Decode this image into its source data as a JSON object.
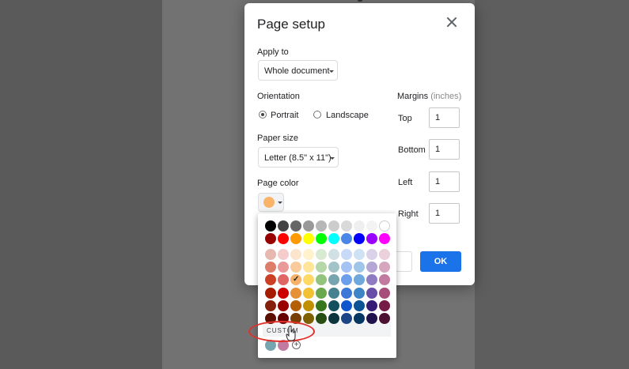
{
  "dialog": {
    "title": "Page setup",
    "apply_to": {
      "label": "Apply to",
      "value": "Whole document"
    },
    "orientation": {
      "label": "Orientation",
      "options": [
        {
          "label": "Portrait",
          "selected": true
        },
        {
          "label": "Landscape",
          "selected": false
        }
      ]
    },
    "paper_size": {
      "label": "Paper size",
      "value": "Letter (8.5\" x 11\")"
    },
    "page_color": {
      "label": "Page color",
      "value": "#f9b36b"
    },
    "margins": {
      "label": "Margins",
      "unit": "(inches)",
      "fields": [
        {
          "label": "Top",
          "value": "1"
        },
        {
          "label": "Bottom",
          "value": "1"
        },
        {
          "label": "Left",
          "value": "1"
        },
        {
          "label": "Right",
          "value": "1"
        }
      ]
    },
    "ok_label": "OK"
  },
  "palette": {
    "rows": [
      [
        "#000000",
        "#434343",
        "#666666",
        "#999999",
        "#b7b7b7",
        "#cccccc",
        "#d9d9d9",
        "#efefef",
        "#f3f3f3",
        "#ffffff"
      ],
      [
        "#980000",
        "#ff0000",
        "#ff9900",
        "#ffff00",
        "#00ff00",
        "#00ffff",
        "#4a86e8",
        "#0000ff",
        "#9900ff",
        "#ff00ff"
      ],
      [
        "#e6b8af",
        "#f4cccc",
        "#fce5cd",
        "#fff2cc",
        "#d9ead3",
        "#d0e0e3",
        "#c9daf8",
        "#cfe2f3",
        "#d9d2e9",
        "#ead1dc"
      ],
      [
        "#dd7e6b",
        "#ea9999",
        "#f9cb9c",
        "#ffe599",
        "#b6d7a8",
        "#a2c4c9",
        "#a4c2f4",
        "#9fc5e8",
        "#b4a7d6",
        "#d5a6bd"
      ],
      [
        "#cc4125",
        "#e06666",
        "#f6b26b",
        "#ffd966",
        "#93c47d",
        "#76a5af",
        "#6d9eeb",
        "#6fa8dc",
        "#8e7cc3",
        "#c27ba0"
      ],
      [
        "#a61c00",
        "#cc0000",
        "#e69138",
        "#f1c232",
        "#6aa84f",
        "#45818e",
        "#3c78d8",
        "#3d85c6",
        "#674ea7",
        "#a64d79"
      ],
      [
        "#85200c",
        "#990000",
        "#b45f06",
        "#bf9000",
        "#38761d",
        "#134f5c",
        "#1155cc",
        "#0b5394",
        "#351c75",
        "#741b47"
      ],
      [
        "#5b0f00",
        "#660000",
        "#783f04",
        "#7f6000",
        "#274e13",
        "#0c343d",
        "#1c4587",
        "#073763",
        "#20124d",
        "#4c1130"
      ]
    ],
    "selected": {
      "row": 4,
      "col": 2
    },
    "custom_label": "CUSTOM",
    "custom_colors": [
      "#76a5af",
      "#c27ba0"
    ]
  }
}
